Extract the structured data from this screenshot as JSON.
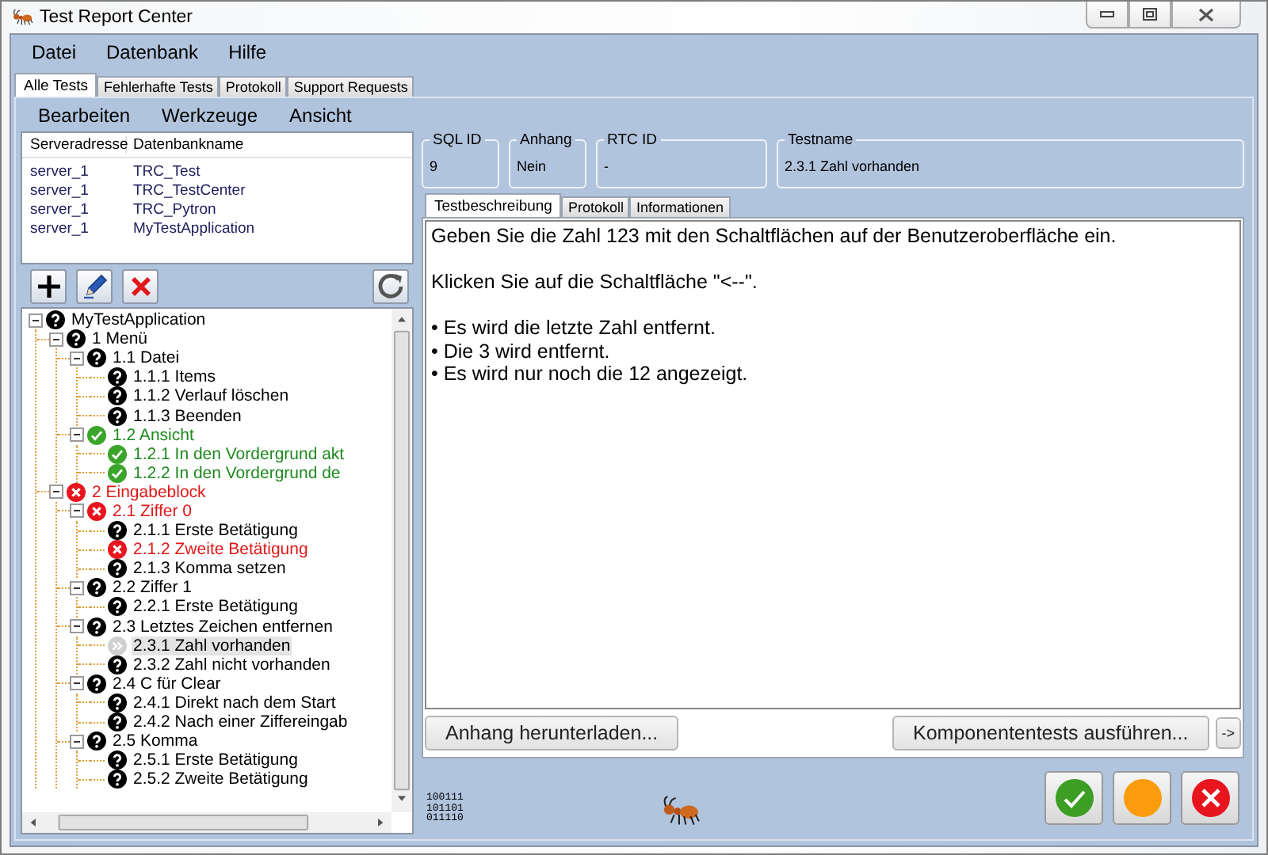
{
  "window": {
    "title": "Test Report Center"
  },
  "menu": [
    "Datei",
    "Datenbank",
    "Hilfe"
  ],
  "tabs": [
    {
      "label": "Alle Tests",
      "selected": true
    },
    {
      "label": "Fehlerhafte Tests",
      "selected": false
    },
    {
      "label": "Protokoll",
      "selected": false
    },
    {
      "label": "Support Requests",
      "selected": false
    }
  ],
  "submenu": [
    "Bearbeiten",
    "Werkzeuge",
    "Ansicht"
  ],
  "servers": {
    "columns": [
      "Serveradresse",
      "Datenbankname"
    ],
    "rows": [
      [
        "server_1",
        "TRC_Test"
      ],
      [
        "server_1",
        "TRC_TestCenter"
      ],
      [
        "server_1",
        "TRC_Pytron"
      ],
      [
        "server_1",
        "MyTestApplication"
      ]
    ]
  },
  "tree": {
    "label": "MyTestApplication",
    "kind": "unknown",
    "expanded": true,
    "selected": false,
    "children": [
      {
        "label": "1 Menü",
        "kind": "unknown",
        "expanded": true,
        "selected": false,
        "children": [
          {
            "label": "1.1 Datei",
            "kind": "unknown",
            "expanded": true,
            "selected": false,
            "children": [
              {
                "label": "1.1.1 Items",
                "kind": "unknown",
                "selected": false
              },
              {
                "label": "1.1.2 Verlauf löschen",
                "kind": "unknown",
                "selected": false
              },
              {
                "label": "1.1.3 Beenden",
                "kind": "unknown",
                "selected": false
              }
            ]
          },
          {
            "label": "1.2 Ansicht",
            "kind": "passed",
            "expanded": true,
            "selected": false,
            "children": [
              {
                "label": "1.2.1 In den Vordergrund akt",
                "kind": "passed",
                "selected": false
              },
              {
                "label": "1.2.2 In den Vordergrund de",
                "kind": "passed",
                "selected": false
              }
            ]
          }
        ]
      },
      {
        "label": "2 Eingabeblock",
        "kind": "failed",
        "expanded": true,
        "selected": false,
        "children": [
          {
            "label": "2.1 Ziffer 0",
            "kind": "failed",
            "expanded": true,
            "selected": false,
            "children": [
              {
                "label": "2.1.1 Erste Betätigung",
                "kind": "unknown",
                "selected": false
              },
              {
                "label": "2.1.2 Zweite Betätigung",
                "kind": "failed",
                "selected": false
              },
              {
                "label": "2.1.3 Komma setzen",
                "kind": "unknown",
                "selected": false
              }
            ]
          },
          {
            "label": "2.2 Ziffer 1",
            "kind": "unknown",
            "expanded": true,
            "selected": false,
            "children": [
              {
                "label": "2.2.1 Erste Betätigung",
                "kind": "unknown",
                "selected": false
              }
            ]
          },
          {
            "label": "2.3 Letztes Zeichen entfernen",
            "kind": "unknown",
            "expanded": true,
            "selected": false,
            "children": [
              {
                "label": "2.3.1 Zahl vorhanden",
                "kind": "skipped",
                "selected": true
              },
              {
                "label": "2.3.2 Zahl nicht vorhanden",
                "kind": "unknown",
                "selected": false
              }
            ]
          },
          {
            "label": "2.4 C für Clear",
            "kind": "unknown",
            "expanded": true,
            "selected": false,
            "children": [
              {
                "label": "2.4.1 Direkt nach dem Start",
                "kind": "unknown",
                "selected": false
              },
              {
                "label": "2.4.2 Nach einer Ziffereingab",
                "kind": "unknown",
                "selected": false
              }
            ]
          },
          {
            "label": "2.5 Komma",
            "kind": "unknown",
            "expanded": true,
            "selected": false,
            "children": [
              {
                "label": "2.5.1 Erste Betätigung",
                "kind": "unknown",
                "selected": false
              },
              {
                "label": "2.5.2 Zweite Betätigung",
                "kind": "unknown",
                "selected": false
              }
            ]
          }
        ]
      }
    ]
  },
  "info": [
    {
      "label": "SQL ID",
      "value": "9"
    },
    {
      "label": "Anhang",
      "value": "Nein"
    },
    {
      "label": "RTC ID",
      "value": "-"
    },
    {
      "label": "Testname",
      "value": "2.3.1 Zahl vorhanden"
    }
  ],
  "detail_tabs": [
    {
      "label": "Testbeschreibung",
      "selected": true
    },
    {
      "label": "Protokoll",
      "selected": false
    },
    {
      "label": "Informationen",
      "selected": false
    }
  ],
  "description": [
    [
      "Geben Sie die Zahl 123 mit den Schaltflächen auf der Benutzeroberfläche ein."
    ],
    [
      "Klicken Sie auf die Schaltfläche \"<--\"."
    ],
    [
      "• Es wird die letzte Zahl entfernt.",
      "• Die 3 wird entfernt.",
      "• Es wird nur noch die 12 angezeigt."
    ]
  ],
  "actions": {
    "download": "Anhang herunterladen...",
    "run": "Komponententests ausführen...",
    "next": "->"
  },
  "logo_text": [
    "100111",
    "101101",
    "011110"
  ]
}
